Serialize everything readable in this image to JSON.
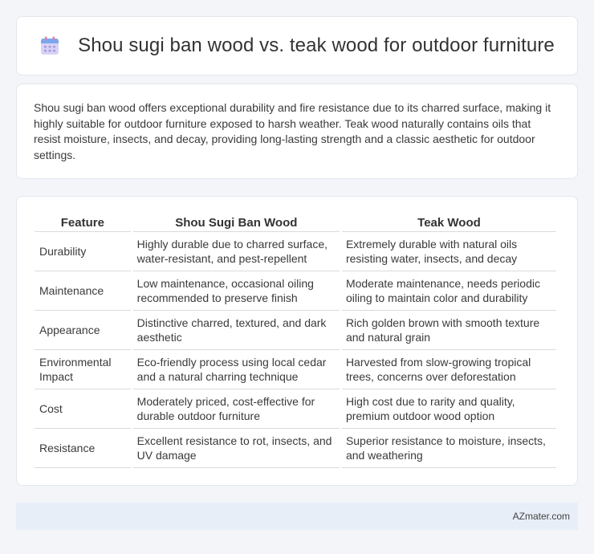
{
  "header": {
    "icon": "calendar-icon",
    "title": "Shou sugi ban wood vs. teak wood for outdoor furniture"
  },
  "intro": {
    "text": "Shou sugi ban wood offers exceptional durability and fire resistance due to its charred surface, making it highly suitable for outdoor furniture exposed to harsh weather. Teak wood naturally contains oils that resist moisture, insects, and decay, providing long-lasting strength and a classic aesthetic for outdoor settings."
  },
  "table": {
    "headers": [
      "Feature",
      "Shou Sugi Ban Wood",
      "Teak Wood"
    ],
    "rows": [
      [
        "Durability",
        "Highly durable due to charred surface, water-resistant, and pest-repellent",
        "Extremely durable with natural oils resisting water, insects, and decay"
      ],
      [
        "Maintenance",
        "Low maintenance, occasional oiling recommended to preserve finish",
        "Moderate maintenance, needs periodic oiling to maintain color and durability"
      ],
      [
        "Appearance",
        "Distinctive charred, textured, and dark aesthetic",
        "Rich golden brown with smooth texture and natural grain"
      ],
      [
        "Environmental Impact",
        "Eco-friendly process using local cedar and a natural charring technique",
        "Harvested from slow-growing tropical trees, concerns over deforestation"
      ],
      [
        "Cost",
        "Moderately priced, cost-effective for durable outdoor furniture",
        "High cost due to rarity and quality, premium outdoor wood option"
      ],
      [
        "Resistance",
        "Excellent resistance to rot, insects, and UV damage",
        "Superior resistance to moisture, insects, and weathering"
      ]
    ]
  },
  "footer": {
    "text": "AZmater.com"
  }
}
